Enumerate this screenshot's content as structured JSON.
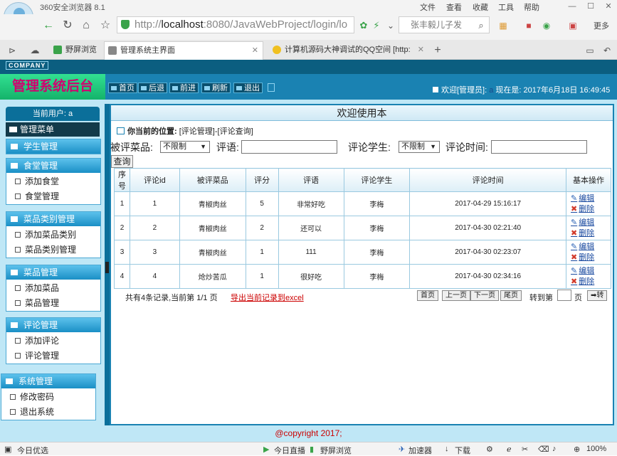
{
  "browser": {
    "title": "360安全浏览器 8.1",
    "menu": [
      "文件",
      "查看",
      "收藏",
      "工具",
      "帮助"
    ],
    "url_prefix": "http://",
    "url_host": "localhost",
    "url_rest": ":8080/JavaWebProject/login/lo",
    "search_text": "张丰毅儿子发",
    "more_label": "更多",
    "tabs": [
      {
        "label": "野屏浏览"
      },
      {
        "label": "管理系统主界面"
      },
      {
        "label": "计算机源码大神调试的QQ空间 [http:"
      }
    ]
  },
  "app": {
    "company": "COMPANY",
    "title": "管理系统后台",
    "header_buttons": [
      "首页",
      "后退",
      "前进",
      "刷新",
      "退出"
    ],
    "welcome": "欢迎[管理员]:",
    "username": "a",
    "now_label": "现在是: 2017年6月18日 16:49:45",
    "current_user": "当前用户: a",
    "menu_title": "管理菜单",
    "groups": [
      {
        "title": "学生管理",
        "items": []
      },
      {
        "title": "食堂管理",
        "items": [
          "添加食堂",
          "食堂管理"
        ]
      },
      {
        "title": "菜品类别管理",
        "items": [
          "添加菜品类别",
          "菜品类别管理"
        ]
      },
      {
        "title": "菜品管理",
        "items": [
          "添加菜品",
          "菜品管理"
        ]
      },
      {
        "title": "评论管理",
        "items": [
          "添加评论",
          "评论管理"
        ]
      },
      {
        "title": "系统管理",
        "items": [
          "修改密码",
          "退出系统"
        ]
      }
    ],
    "main_title": "欢迎使用本",
    "location_label": "你当前的位置:",
    "location_path": "[评论管理]-[评论查询]",
    "filters": {
      "dish_label": "被评菜品:",
      "dish_value": "不限制",
      "comment_label": "评语:",
      "student_label": "评论学生:",
      "student_value": "不限制",
      "time_label": "评论时间:",
      "query_button": "查询"
    },
    "table": {
      "headers": [
        "序号",
        "评论id",
        "被评菜品",
        "评分",
        "评语",
        "评论学生",
        "评论时间",
        "基本操作"
      ],
      "rows": [
        [
          "1",
          "1",
          "青椒肉丝",
          "5",
          "非常好吃",
          "李梅",
          "2017-04-29 15:16:17"
        ],
        [
          "2",
          "2",
          "青椒肉丝",
          "2",
          "还可以",
          "李梅",
          "2017-04-30 02:21:40"
        ],
        [
          "3",
          "3",
          "青椒肉丝",
          "1",
          "111",
          "李梅",
          "2017-04-30 02:23:07"
        ],
        [
          "4",
          "4",
          "炝炒苦瓜",
          "1",
          "很好吃",
          "李梅",
          "2017-04-30 02:34:16"
        ]
      ],
      "edit_label": "编辑",
      "delete_label": "删除"
    },
    "pager": {
      "summary": "共有4条记录,当前第 1/1 页",
      "export": "导出当前记录到excel",
      "first": "首页",
      "prev": "上一页",
      "next": "下一页",
      "last": "尾页",
      "goto_label": "转到第",
      "page_unit": "页",
      "go": "转"
    },
    "footer": "@copyright 2017;"
  },
  "statusbar": {
    "left": "今日优选",
    "items": [
      "今日直播",
      "野屏浏览",
      "加速器",
      "下载"
    ],
    "zoom": "100%"
  }
}
